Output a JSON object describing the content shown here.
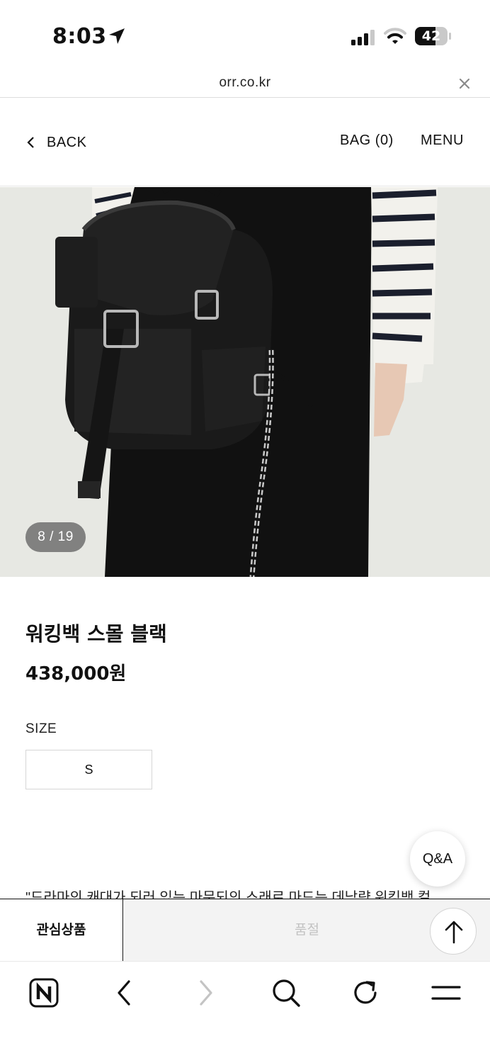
{
  "status_bar": {
    "time": "8:03",
    "battery": "42",
    "location_icon": "location-arrow-icon",
    "signal_icon": "cellular-signal-icon",
    "wifi_icon": "wifi-icon",
    "battery_icon": "battery-icon"
  },
  "address_bar": {
    "url": "orr.co.kr",
    "close_icon": "close-icon"
  },
  "header": {
    "back_label": "BACK",
    "bag_label": "BAG (0)",
    "menu_label": "MENU"
  },
  "gallery": {
    "counter": "8 / 19",
    "current": 8,
    "total": 19
  },
  "product": {
    "name": "워킹백 스몰 블랙",
    "price": "438,000원",
    "size_label": "SIZE",
    "size_options": [
      "S"
    ],
    "description_excerpt": "\"드라마의 캐대가 되러 있는 마문되의 스래로 마드는 데남량 워킹백 컬"
  },
  "floating": {
    "qa_label": "Q&A",
    "scroll_top_icon": "arrow-up-icon"
  },
  "action_bar": {
    "wishlist_label": "관심상품",
    "soldout_label": "품절"
  },
  "browser_toolbar": {
    "icons": [
      "naver-home-icon",
      "back-arrow-icon",
      "forward-arrow-icon",
      "search-icon",
      "refresh-icon",
      "menu-icon"
    ]
  },
  "colors": {
    "text": "#111111",
    "soldout_bg": "#f3f3f3",
    "soldout_text": "#c2c2c2",
    "counter_bg": "#6e6e6e"
  }
}
